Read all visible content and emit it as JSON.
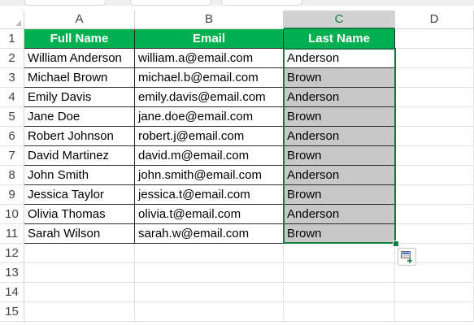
{
  "columns": [
    "A",
    "B",
    "C",
    "D"
  ],
  "selected_column": "C",
  "row_numbers": [
    "1",
    "2",
    "3",
    "4",
    "5",
    "6",
    "7",
    "8",
    "9",
    "10",
    "11",
    "12",
    "13",
    "14",
    "15"
  ],
  "table": {
    "headers": [
      "Full Name",
      "Email",
      "Last Name"
    ],
    "rows": [
      [
        "William Anderson",
        "william.a@email.com",
        "Anderson"
      ],
      [
        "Michael Brown",
        "michael.b@email.com",
        "Brown"
      ],
      [
        "Emily Davis",
        "emily.davis@email.com",
        "Anderson"
      ],
      [
        "Jane Doe",
        "jane.doe@email.com",
        "Brown"
      ],
      [
        "Robert Johnson",
        "robert.j@email.com",
        "Anderson"
      ],
      [
        "David Martinez",
        "david.m@email.com",
        "Brown"
      ],
      [
        "John Smith",
        "john.smith@email.com",
        "Anderson"
      ],
      [
        "Jessica Taylor",
        "jessica.t@email.com",
        "Brown"
      ],
      [
        "Olivia Thomas",
        "olivia.t@email.com",
        "Anderson"
      ],
      [
        "Sarah Wilson",
        "sarah.w@email.com",
        "Brown"
      ]
    ]
  },
  "colors": {
    "header_fill": "#00b050",
    "header_text": "#ffffff",
    "selection_green": "#107c41",
    "filled_cell_gray": "#c8c8c8"
  },
  "icons": {
    "quick_fill_options": "flash-fill-options-icon",
    "select_all_corner": "select-all-triangle-icon"
  }
}
